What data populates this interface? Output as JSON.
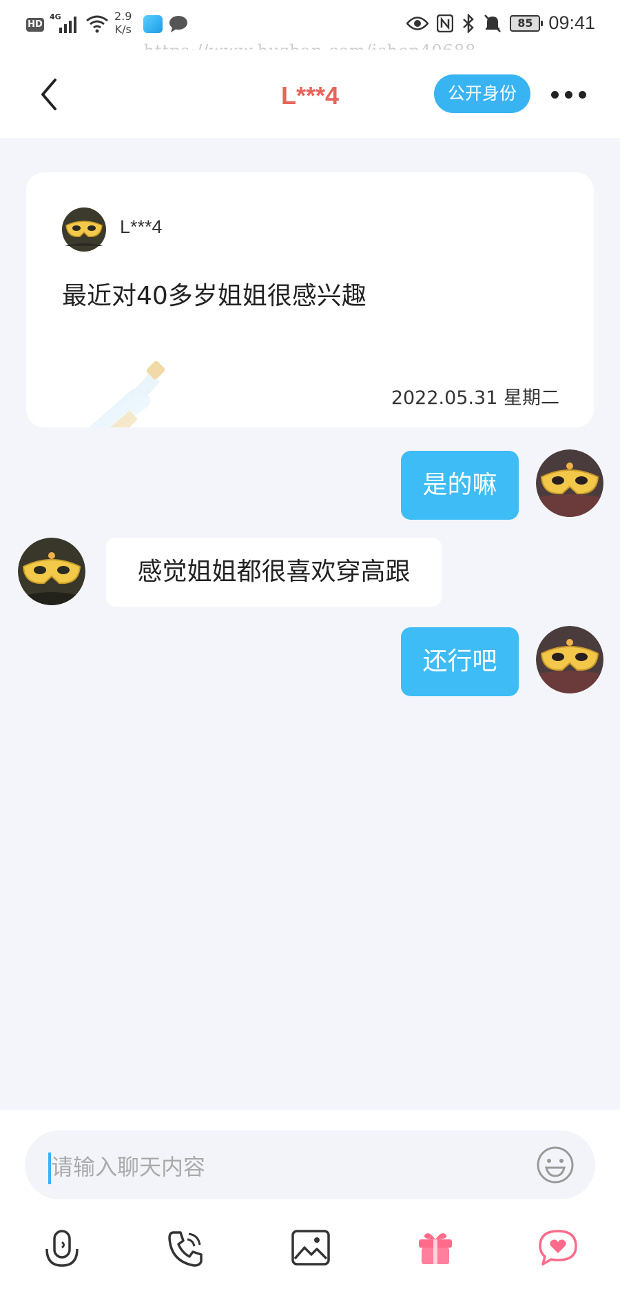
{
  "status": {
    "network": "4G",
    "speed_value": "2.9",
    "speed_unit": "K/s",
    "battery": "85",
    "time": "09:41"
  },
  "watermark": "https://www.huzhan.com/ishop40688",
  "header": {
    "title": "L***4",
    "reveal_button": "公开身份"
  },
  "card": {
    "username": "L***4",
    "text": "最近对40多岁姐姐很感兴趣",
    "date": "2022.05.31  星期二"
  },
  "messages": [
    {
      "side": "out",
      "text": "是的嘛"
    },
    {
      "side": "in",
      "text": "感觉姐姐都很喜欢穿高跟"
    },
    {
      "side": "out",
      "text": "还行吧"
    }
  ],
  "input": {
    "placeholder": "请输入聊天内容"
  },
  "toolbar_icons": [
    "voice-icon",
    "phone-icon",
    "image-icon",
    "gift-icon",
    "heart-chat-icon"
  ],
  "colors": {
    "accent": "#38b4f2",
    "title": "#e9645a",
    "bubble_out": "#3ebcf6"
  }
}
